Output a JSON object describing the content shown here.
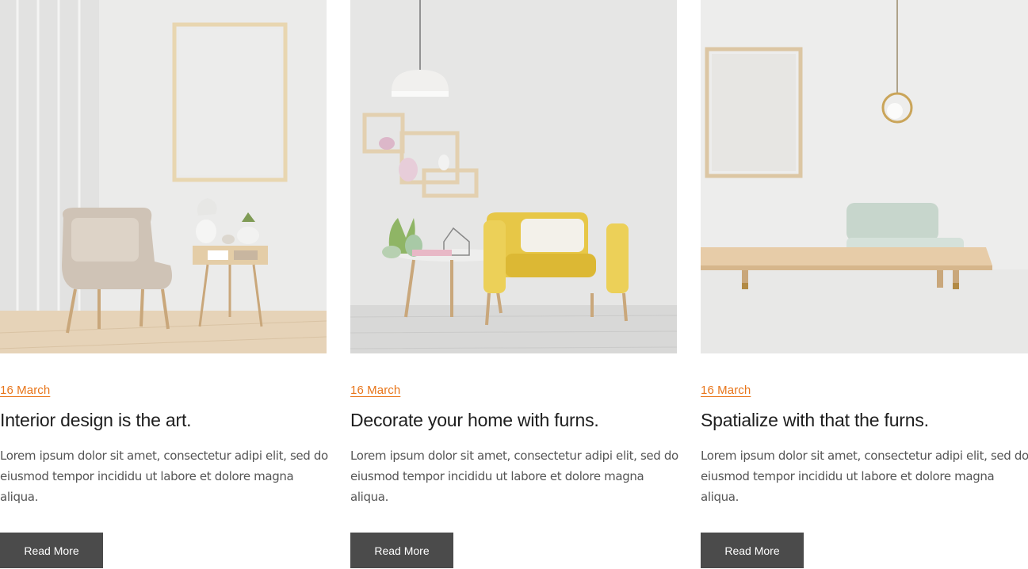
{
  "posts": [
    {
      "date": "16 March",
      "title": "Interior design is the art.",
      "excerpt": "Lorem ipsum dolor sit amet, consectetur adipi elit, sed do eiusmod tempor incididu ut labore et dolore magna aliqua.",
      "button": "Read More",
      "image": "room-with-beige-armchair-and-side-table"
    },
    {
      "date": "16 March",
      "title": "Decorate your home with furns.",
      "excerpt": "Lorem ipsum dolor sit amet, consectetur adipi elit, sed do eiusmod tempor incididu ut labore et dolore magna aliqua.",
      "button": "Read More",
      "image": "room-with-yellow-armchair-and-wall-shelves"
    },
    {
      "date": "16 March",
      "title": "Spatialize with that the furns.",
      "excerpt": "Lorem ipsum dolor sit amet, consectetur adipi elit, sed do eiusmod tempor incididu ut labore et dolore magna aliqua.",
      "button": "Read More",
      "image": "room-with-wooden-daybed-and-pendant-lamp"
    }
  ],
  "colors": {
    "date": "#e8751a",
    "button": "#4b4b4b",
    "title": "#1e1e1e",
    "excerpt": "#555555"
  }
}
